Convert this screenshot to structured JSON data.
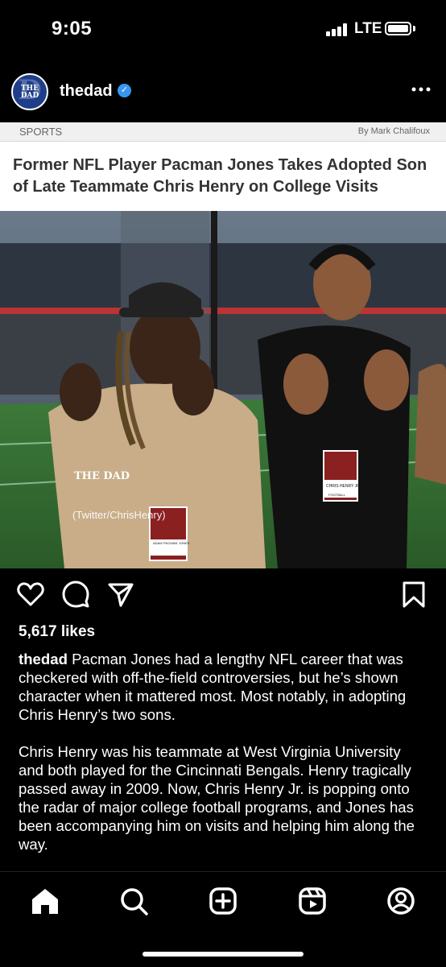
{
  "status_bar": {
    "time": "9:05",
    "network": "LTE"
  },
  "post": {
    "username": "thedad",
    "avatar_text": "THE DAD",
    "verified_icon": "verified-badge-icon",
    "more_icon": "more-options-icon"
  },
  "article": {
    "category": "SPORTS",
    "byline": "By Mark Chalifoux",
    "headline": "Former NFL Player Pacman Jones Takes Adopted Son of Late Teammate Chris Henry on College Visits"
  },
  "photo": {
    "watermark": "THE DAD",
    "credit": "(Twitter/ChrisHenry)",
    "badge_left": "ADAM 'PACMAN' JONES",
    "badge_right": "CHRIS HENRY JR",
    "badge_footer": "FOOTBALL"
  },
  "actions": {
    "like_icon": "heart-icon",
    "comment_icon": "comment-icon",
    "share_icon": "send-icon",
    "save_icon": "bookmark-icon"
  },
  "likes": "5,617 likes",
  "caption": {
    "username": "thedad",
    "paragraph1": "Pacman Jones had a lengthy NFL career that was checkered with off-the-field controversies, but he’s shown character when it mattered most. Most notably, in adopting Chris Henry’s two sons.",
    "paragraph2": "Chris Henry was his teammate at West Virginia University and both played for the Cincinnati Bengals. Henry tragically passed away in 2009. Now, Chris Henry Jr. is popping onto the radar of major college football programs, and Jones has been accompanying him on visits and helping him along the way."
  },
  "nav": {
    "items": [
      "home-icon",
      "search-icon",
      "create-icon",
      "reels-icon",
      "profile-icon"
    ]
  },
  "colors": {
    "background": "#000000",
    "verified": "#3797f0",
    "avatar": "#1e3e8a"
  }
}
